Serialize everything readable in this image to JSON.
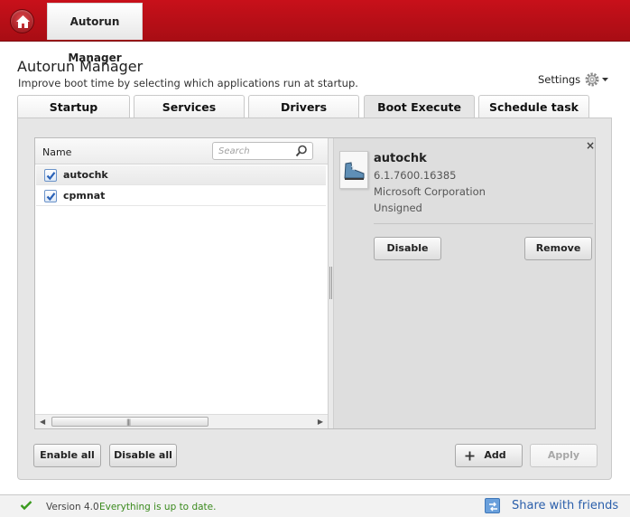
{
  "app": {
    "tab_title": "Autorun Manager"
  },
  "header": {
    "title": "Autorun Manager",
    "subtitle": "Improve boot time by selecting which applications run at startup.",
    "settings_label": "Settings"
  },
  "tabs": [
    {
      "label": "Startup",
      "active": false
    },
    {
      "label": "Services",
      "active": false
    },
    {
      "label": "Drivers",
      "active": false
    },
    {
      "label": "Boot Execute",
      "active": true
    },
    {
      "label": "Schedule task",
      "active": false
    }
  ],
  "list": {
    "column_name": "Name",
    "search_placeholder": "Search",
    "items": [
      {
        "label": "autochk",
        "checked": true,
        "selected": true
      },
      {
        "label": "cpmnat",
        "checked": true,
        "selected": false
      }
    ]
  },
  "detail": {
    "name": "autochk",
    "version": "6.1.7600.16385",
    "company": "Microsoft Corporation",
    "signature": "Unsigned",
    "disable_label": "Disable",
    "remove_label": "Remove",
    "close_glyph": "×"
  },
  "actions": {
    "enable_all": "Enable all",
    "disable_all": "Disable all",
    "add": "Add",
    "apply": "Apply"
  },
  "status": {
    "version": "Version  4.0",
    "message": "Everything is up to date.",
    "share": "Share with friends"
  },
  "colors": {
    "topbar": "#c8101a",
    "status_ok": "#3a8a1d",
    "link": "#2b5fab",
    "checkbox": "#2a62b8"
  }
}
